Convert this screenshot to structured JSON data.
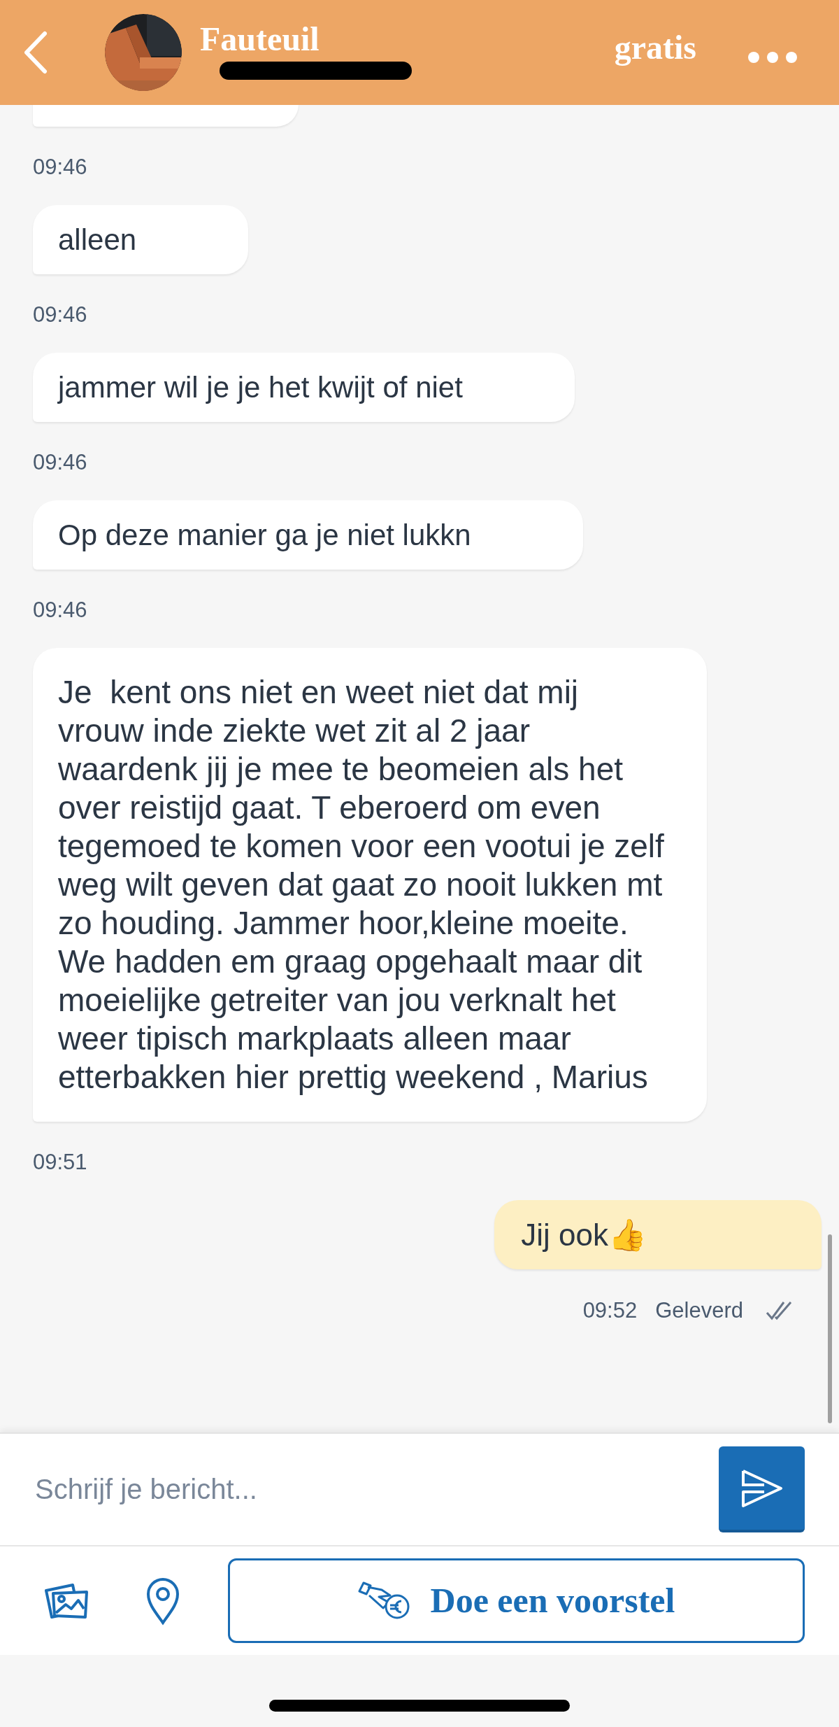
{
  "header": {
    "title": "Fauteuil",
    "subtitle_redacted": true,
    "price": "gratis"
  },
  "earlier_message_cut": true,
  "messages": [
    {
      "kind": "incoming",
      "time_before": "09:46",
      "text": "alleen"
    },
    {
      "kind": "incoming",
      "time_before": "09:46",
      "text": "jammer wil je je het kwijt of niet"
    },
    {
      "kind": "incoming",
      "time_before": "09:46",
      "text": "Op deze manier ga je niet lukkn"
    },
    {
      "kind": "incoming",
      "time_before": "09:46",
      "text": "Je  kent ons niet en weet niet dat mij vrouw inde ziekte wet zit al 2 jaar waardenk jij je mee te beomeien als het over reistijd gaat. T eberoerd om even tegemoed te komen voor een vootui je zelf weg wilt geven dat gaat zo nooit lukken mt zo houding. Jammer hoor,kleine moeite. We hadden em graag opgehaalt maar dit moeielijke getreiter van jou verknalt het weer tipisch markplaats alleen maar etterbakken hier prettig weekend , Marius"
    },
    {
      "kind": "outgoing",
      "time_before": "09:51",
      "text": "Jij ook👍",
      "time": "09:52",
      "status": "Geleverd",
      "delivered": true
    }
  ],
  "composer": {
    "placeholder": "Schrijf je bericht..."
  },
  "offer_button": "Doe een voorstel"
}
